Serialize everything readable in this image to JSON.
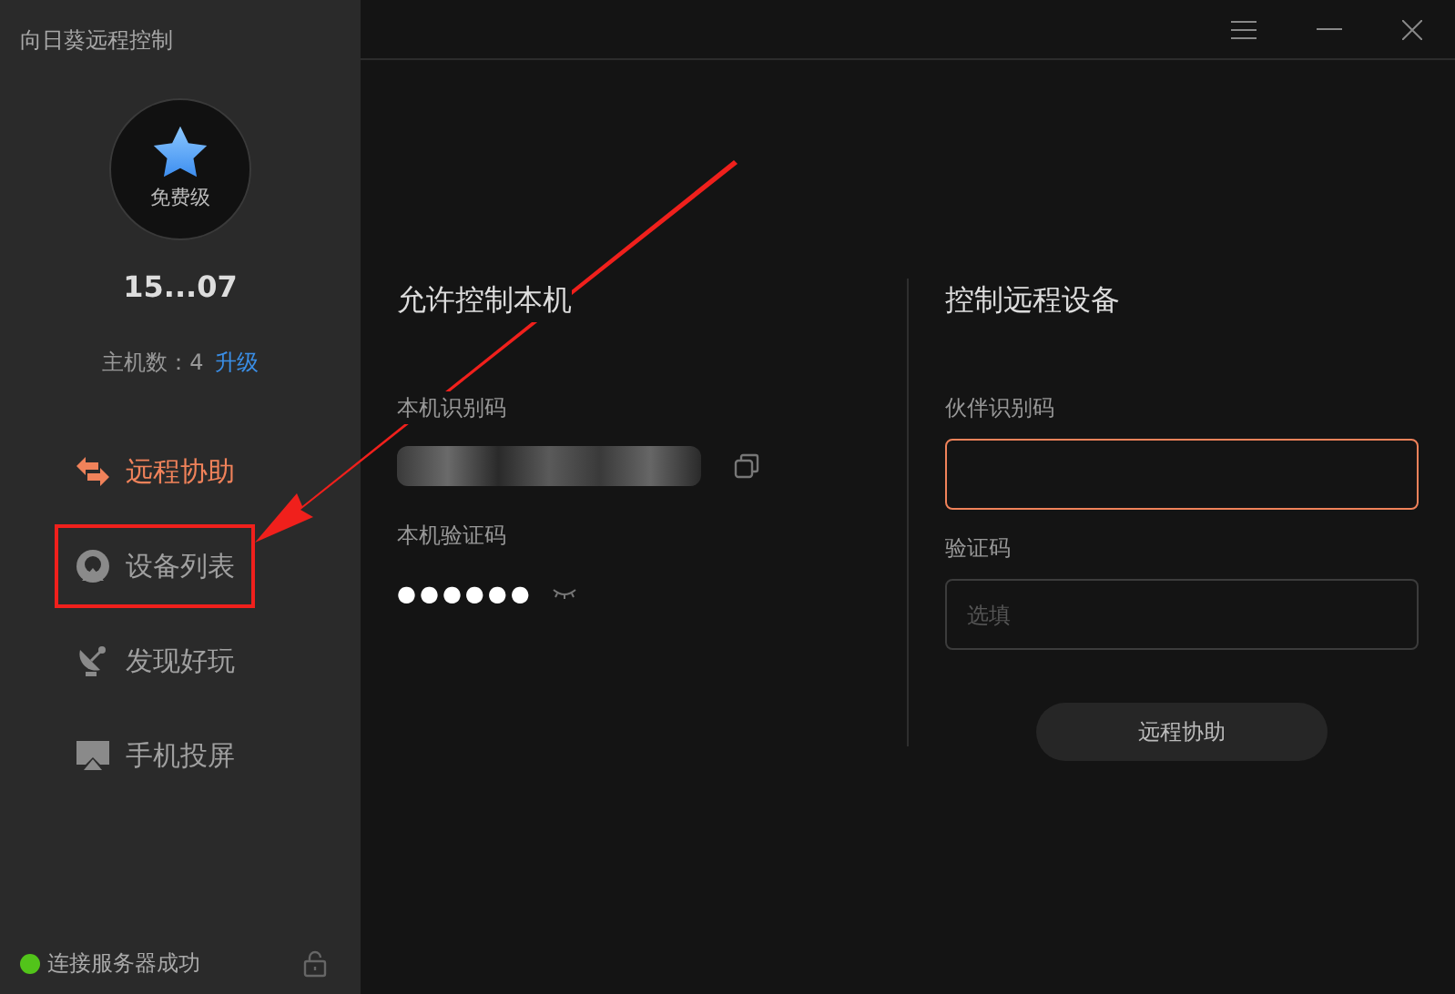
{
  "window": {
    "title": "向日葵远程控制"
  },
  "account": {
    "level": "免费级",
    "user": "15...07",
    "hosts_label": "主机数：4",
    "upgrade_link": "升级"
  },
  "nav": [
    {
      "label": "远程协助",
      "selected": true,
      "highlighted": false
    },
    {
      "label": "设备列表",
      "selected": false,
      "highlighted": true
    },
    {
      "label": "发现好玩",
      "selected": false,
      "highlighted": false
    },
    {
      "label": "手机投屏",
      "selected": false,
      "highlighted": false
    }
  ],
  "status": {
    "text": "连接服务器成功",
    "color": "#52c41a"
  },
  "local": {
    "title": "允许控制本机",
    "id_label": "本机识别码",
    "code_label": "本机验证码",
    "code": "●●●●●●"
  },
  "remote": {
    "title": "控制远程设备",
    "partner_label": "伙伴识别码",
    "partner_focused": true,
    "code_label": "验证码",
    "code_placeholder": "选填",
    "button": "远程协助"
  }
}
